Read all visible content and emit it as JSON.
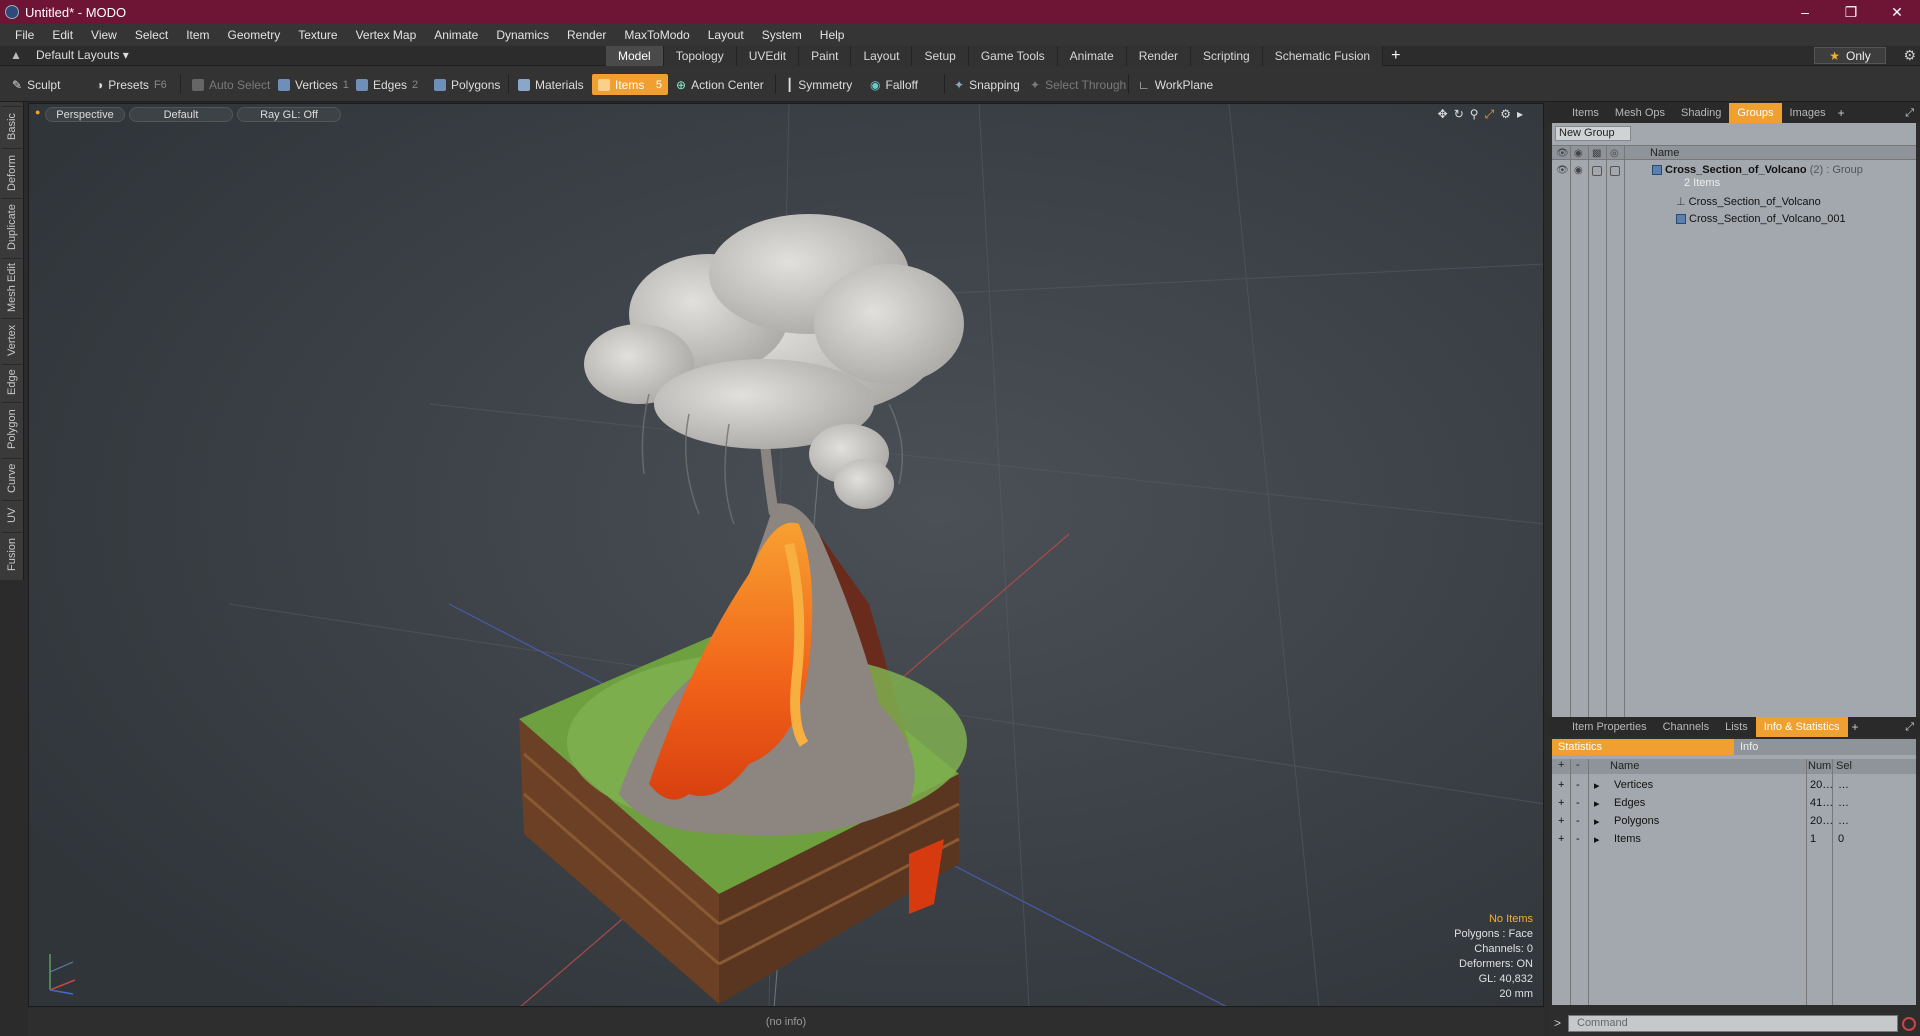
{
  "window": {
    "title": "Untitled* - MODO",
    "min": "–",
    "max": "❐",
    "close": "✕"
  },
  "menu": [
    "File",
    "Edit",
    "View",
    "Select",
    "Item",
    "Geometry",
    "Texture",
    "Vertex Map",
    "Animate",
    "Dynamics",
    "Render",
    "MaxToModo",
    "Layout",
    "System",
    "Help"
  ],
  "layout_bar": {
    "selector": "Default Layouts ▾",
    "tabs": [
      "Model",
      "Topology",
      "UVEdit",
      "Paint",
      "Layout",
      "Setup",
      "Game Tools",
      "Animate",
      "Render",
      "Scripting",
      "Schematic Fusion"
    ],
    "active_tab": "Model",
    "add": "+",
    "only": "Only"
  },
  "toolbar": {
    "sculpt": "Sculpt",
    "presets": "Presets",
    "presets_key": "F6",
    "auto_select": "Auto Select",
    "vertices": "Vertices",
    "vertices_key": "1",
    "edges": "Edges",
    "edges_key": "2",
    "polygons": "Polygons",
    "materials": "Materials",
    "items": "Items",
    "items_key": "5",
    "action_center": "Action Center",
    "symmetry": "Symmetry",
    "falloff": "Falloff",
    "snapping": "Snapping",
    "select_through": "Select Through",
    "workplane": "WorkPlane"
  },
  "left_tabs": [
    "Basic",
    "Deform",
    "Duplicate",
    "Mesh Edit",
    "Vertex",
    "Edge",
    "Polygon",
    "Curve",
    "UV",
    "Fusion"
  ],
  "viewport": {
    "projection": "Perspective",
    "shading": "Default",
    "raygl": "Ray GL: Off",
    "hud": {
      "no_items": "No Items",
      "polygons": "Polygons : Face",
      "channels": "Channels: 0",
      "deformers": "Deformers: ON",
      "gl": "GL: 40,832",
      "scale": "20 mm"
    }
  },
  "status": "(no info)",
  "groups_panel": {
    "tabs": [
      "Items",
      "Mesh Ops",
      "Shading",
      "Groups",
      "Images"
    ],
    "active": "Groups",
    "new_group": "New Group",
    "name_header": "Name",
    "group_name": "Cross_Section_of_Volcano",
    "group_count": "(2)",
    "group_type": ": Group",
    "group_sub": "2 Items",
    "children": [
      "Cross_Section_of_Volcano",
      "Cross_Section_of_Volcano_001"
    ]
  },
  "info_panel": {
    "tabs": [
      "Item Properties",
      "Channels",
      "Lists",
      "Info & Statistics"
    ],
    "active": "Info & Statistics",
    "sub_tabs": [
      "Statistics",
      "Info"
    ],
    "headers": {
      "name": "Name",
      "num": "Num",
      "sel": "Sel"
    },
    "rows": [
      {
        "name": "Vertices",
        "num": "20…",
        "sel": "…"
      },
      {
        "name": "Edges",
        "num": "41…",
        "sel": "…"
      },
      {
        "name": "Polygons",
        "num": "20…",
        "sel": "…"
      },
      {
        "name": "Items",
        "num": "1",
        "sel": "0"
      }
    ]
  },
  "command": {
    "placeholder": "Command"
  },
  "colors": {
    "accent": "#f0a030",
    "titlebar": "#6e1535"
  }
}
